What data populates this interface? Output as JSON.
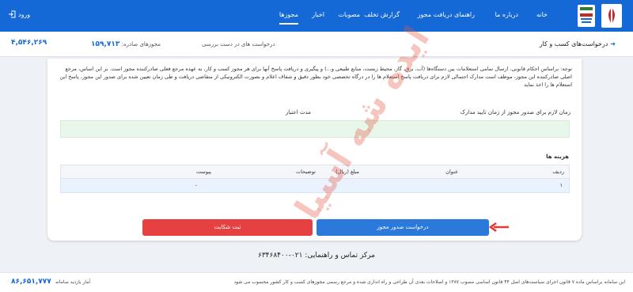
{
  "topnav": {
    "items": [
      {
        "label": "خانه"
      },
      {
        "label": "درباره ما"
      },
      {
        "label": "راهنمای دریافت مجوز"
      },
      {
        "label": "گزارش تخلف"
      },
      {
        "label": "مصوبات"
      },
      {
        "label": "اخبار"
      },
      {
        "label": "مجوزها"
      }
    ],
    "login_label": "ورود",
    "accent": "#1569d6"
  },
  "subbar": {
    "title": "درخواست‌های کسب و کار",
    "pending_label": "درخواست های در دست بررسی",
    "issued_label": "مجوزهای صادره",
    "issued_count": "۱۵۹,۷۱۳",
    "total_count": "۴,۵۴۶,۲۶۹"
  },
  "notice": {
    "text": "توجه: براساس احکام قانونی، ارسال تمامی استعلامات بین دستگاه‌ها (آب، برق، گاز، محیط زیست، منابع طبیعی و...) و پیگیری و دریافت پاسخ آنها برای هر مجوز کسب و کار، به عهده مرجع فعلی صادرکننده مجوز است. بر این اساس، مرجع اصلی صادرکننده این مجوز، موظف است مدارک احتمالی لازم برای دریافت پاسخ استعلام ها را در درگاه تخصصی خود بطور دقیق و شفاف اعلام و بصورت الکترونیکی از متقاضی دریافت و طی زمان تعیین شده برای صدور این مجوز، پاسخ این استعلام ها را اخذ نماید"
  },
  "issuance": {
    "time_label": "زمان لازم برای صدور مجوز از زمان تایید مدارک",
    "validity_label": "مدت اعتبار"
  },
  "fees": {
    "title": "هزینه ها",
    "columns": [
      "ردیف",
      "عنوان",
      "مبلغ (ریال)",
      "توضیحات",
      "پیوست"
    ],
    "rows": [
      {
        "index": "۱",
        "title": "",
        "amount": "",
        "description": "",
        "attachment": "-"
      }
    ]
  },
  "buttons": {
    "request_label": "درخواست صدور مجوز",
    "complaint_label": "ثبت شکایت",
    "request_color": "#2c79dc",
    "complaint_color": "#e54141"
  },
  "contact": {
    "text": "مرکز تماس و راهنمایی: ۰۲۱-۶۳۴۶۸۴۰۰"
  },
  "footer": {
    "note": "این سامانه براساس ماده ۷ قانون اجرای سیاست‌های اصل ۴۴ قانون اساسی مصوب ۱۳۸۷ و اصلاحات بعدی آن طراحی و راه اندازی شده و مرجع رسمی مجوزهای کسب و کار کشور محسوب می شود",
    "visits_label": "آمار بازدید سامانه",
    "visits_count": "۸۶,۶۵۱,۷۷۷"
  },
  "watermark": "ایده شه آسیا"
}
